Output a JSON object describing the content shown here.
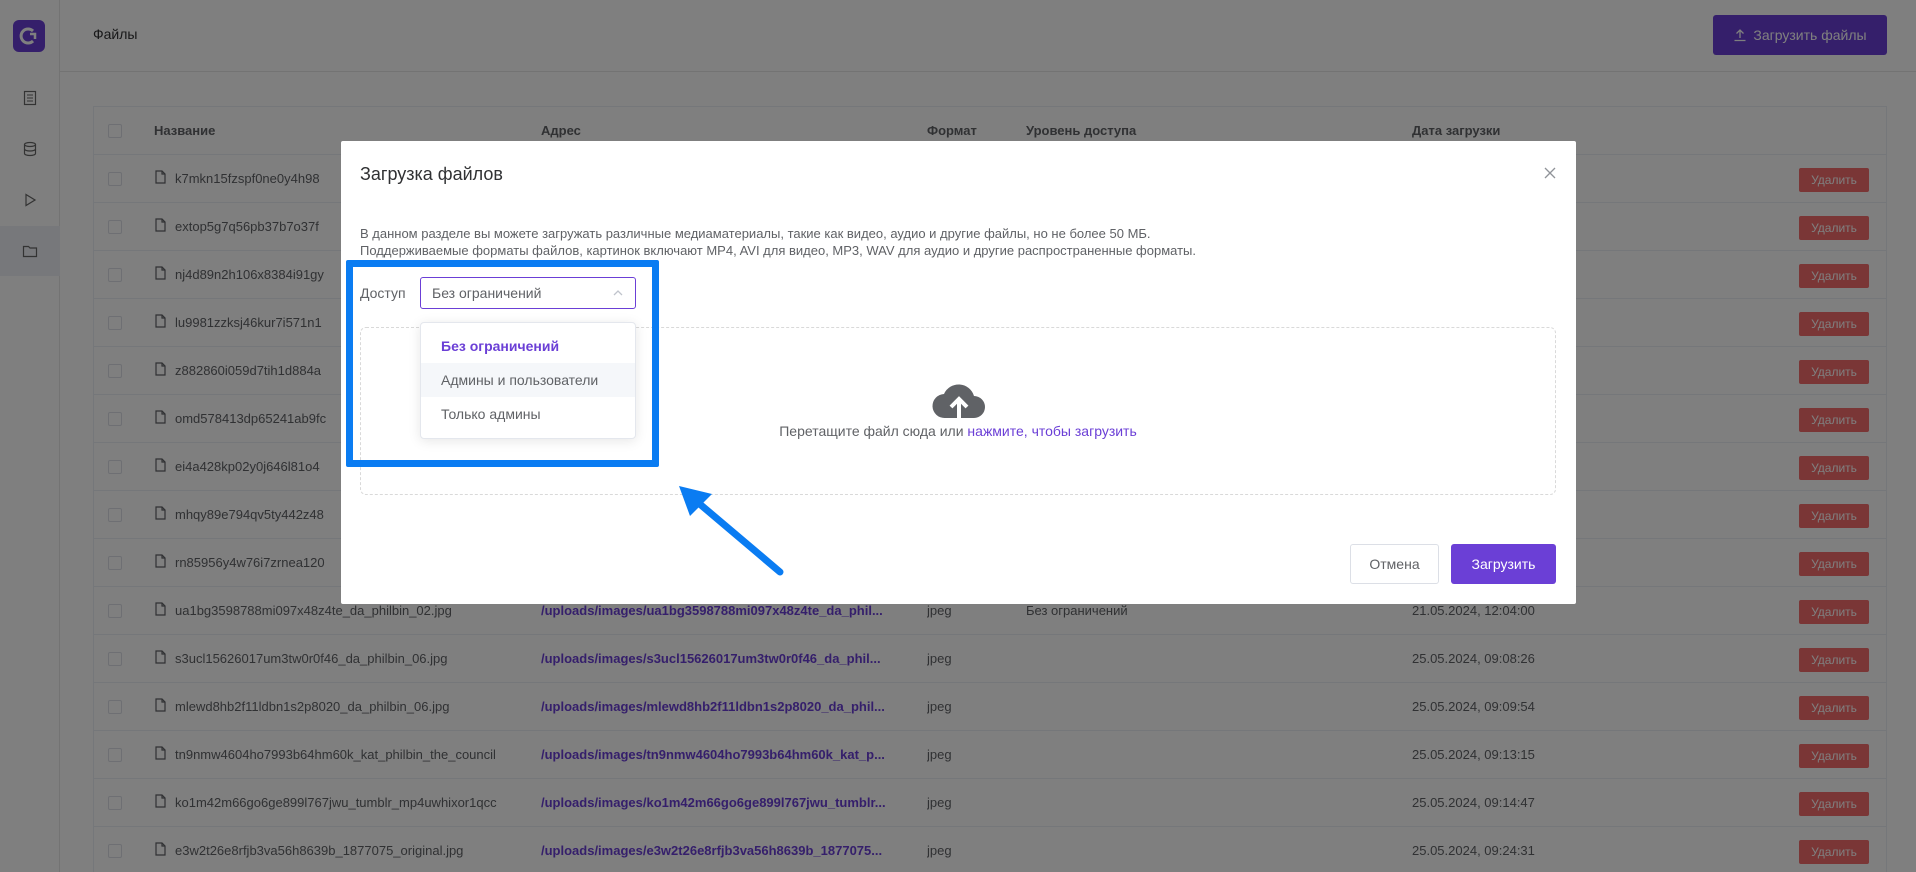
{
  "header": {
    "title": "Файлы",
    "upload_button": "Загрузить файлы"
  },
  "sidebar": {
    "items": [
      "pages-icon",
      "database-icon",
      "play-icon",
      "folder-icon"
    ]
  },
  "table": {
    "columns": {
      "name": "Название",
      "address": "Адрес",
      "format": "Формат",
      "access": "Уровень доступа",
      "date": "Дата загрузки"
    },
    "delete_label": "Удалить",
    "rows": [
      {
        "name": "k7mkn15fzspf0ne0y4h98",
        "address": "",
        "format": "",
        "access": "",
        "date": ""
      },
      {
        "name": "extop5g7q56pb37b7o37f",
        "address": "",
        "format": "",
        "access": "",
        "date": ""
      },
      {
        "name": "nj4d89n2h106x8384i91gy",
        "address": "",
        "format": "",
        "access": "",
        "date": ""
      },
      {
        "name": "lu9981zzksj46kur7i571n1",
        "address": "",
        "format": "",
        "access": "",
        "date": ""
      },
      {
        "name": "z882860i059d7tih1d884a",
        "address": "",
        "format": "",
        "access": "",
        "date": ""
      },
      {
        "name": "omd578413dp65241ab9fc",
        "address": "",
        "format": "",
        "access": "",
        "date": ""
      },
      {
        "name": "ei4a428kp02y0j646l81o4",
        "address": "",
        "format": "",
        "access": "",
        "date": ""
      },
      {
        "name": "mhqy89e794qv5ty442z48",
        "address": "",
        "format": "",
        "access": "",
        "date": ""
      },
      {
        "name": "rn85956y4w76i7zrnea120",
        "address": "",
        "format": "",
        "access": "",
        "date": ""
      },
      {
        "name": "ua1bg3598788mi097x48z4te_da_philbin_02.jpg",
        "address": "/uploads/images/ua1bg3598788mi097x48z4te_da_phil...",
        "format": "jpeg",
        "access": "Без ограничений",
        "date": "21.05.2024, 12:04:00"
      },
      {
        "name": "s3ucl15626017um3tw0r0f46_da_philbin_06.jpg",
        "address": "/uploads/images/s3ucl15626017um3tw0r0f46_da_phil...",
        "format": "jpeg",
        "access": "",
        "date": "25.05.2024, 09:08:26"
      },
      {
        "name": "mlewd8hb2f11ldbn1s2p8020_da_philbin_06.jpg",
        "address": "/uploads/images/mlewd8hb2f11ldbn1s2p8020_da_phil...",
        "format": "jpeg",
        "access": "",
        "date": "25.05.2024, 09:09:54"
      },
      {
        "name": "tn9nmw4604ho7993b64hm60k_kat_philbin_the_council",
        "address": "/uploads/images/tn9nmw4604ho7993b64hm60k_kat_p...",
        "format": "jpeg",
        "access": "",
        "date": "25.05.2024, 09:13:15"
      },
      {
        "name": "ko1m42m66go6ge899l767jwu_tumblr_mp4uwhixor1qcc",
        "address": "/uploads/images/ko1m42m66go6ge899l767jwu_tumblr...",
        "format": "jpeg",
        "access": "",
        "date": "25.05.2024, 09:14:47"
      },
      {
        "name": "e3w2t26e8rfjb3va56h8639b_1877075_original.jpg",
        "address": "/uploads/images/e3w2t26e8rfjb3va56h8639b_1877075...",
        "format": "jpeg",
        "access": "",
        "date": "25.05.2024, 09:24:31"
      }
    ]
  },
  "modal": {
    "title": "Загрузка файлов",
    "description_line1": "В данном разделе вы можете загружать различные медиаматериалы, такие как видео, аудио и другие файлы, но не более 50 МБ.",
    "description_line2": "Поддерживаемые форматы файлов, картинок включают MP4, AVI для видео, MP3, WAV для аудио и другие распространенные форматы.",
    "access_label": "Доступ",
    "access_value": "Без ограничений",
    "access_options": [
      "Без ограничений",
      "Админы и пользователи",
      "Только админы"
    ],
    "dropzone_text": "Перетащите файл сюда или ",
    "dropzone_link": "нажмите, чтобы загрузить",
    "cancel_label": "Отмена",
    "upload_label": "Загрузить"
  },
  "colors": {
    "accent": "#6b3fd6",
    "danger": "#f56c6c",
    "annotation": "#0a7cf2"
  }
}
